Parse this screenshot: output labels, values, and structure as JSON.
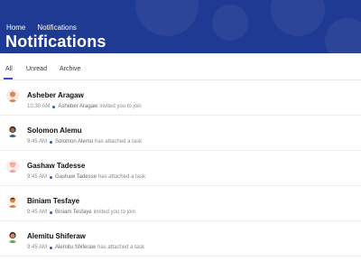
{
  "breadcrumb": {
    "items": [
      "Home",
      "Notifications"
    ]
  },
  "page_title": "Notifications",
  "colors": {
    "header_bg": "#1f3a93",
    "accent": "#2f55d4"
  },
  "tabs": [
    {
      "label": "All",
      "active": true
    },
    {
      "label": "Unread",
      "active": false
    },
    {
      "label": "Archive",
      "active": false
    }
  ],
  "notifications": [
    {
      "name": "Asheber Aragaw",
      "time": "10:30 AM",
      "actor": "Asheber Aragaw",
      "action": "invited you to join",
      "avatar": "avatar-icon"
    },
    {
      "name": "Solomon Alemu",
      "time": "9:45 AM",
      "actor": "Solomon Alemu",
      "action": "has attached a task",
      "avatar": "avatar-icon"
    },
    {
      "name": "Gashaw Tadesse",
      "time": "9:45 AM",
      "actor": "Gashaw Tadesse",
      "action": "has attached a task",
      "avatar": "avatar-icon"
    },
    {
      "name": "Biniam Tesfaye",
      "time": "9:45 AM",
      "actor": "Biniam Tesfaye",
      "action": "invited you to join",
      "avatar": "avatar-icon"
    },
    {
      "name": "Alemitu Shiferaw",
      "time": "9:45 AM",
      "actor": "Alemitu Shiferaw",
      "action": "has attached a task",
      "avatar": "avatar-icon"
    }
  ]
}
